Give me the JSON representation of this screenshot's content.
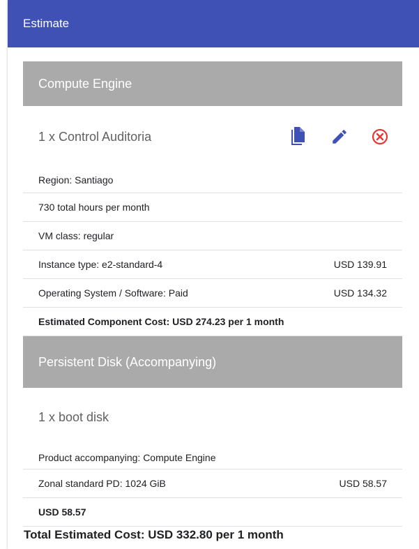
{
  "colors": {
    "header_bg": "#3f51b5",
    "section_bg": "#aaaaaa",
    "icon_blue": "#3f51b5",
    "delete_red": "#e53935"
  },
  "header": {
    "title": "Estimate"
  },
  "compute": {
    "section_title": "Compute Engine",
    "item_title": "1 x Control Auditoria",
    "actions": [
      "copy-icon",
      "edit-icon",
      "delete-icon"
    ],
    "rows": [
      {
        "label": "Region: Santiago",
        "price": ""
      },
      {
        "label": "730 total hours per month",
        "price": ""
      },
      {
        "label": "VM class: regular",
        "price": ""
      },
      {
        "label": "Instance type: e2-standard-4",
        "price": "USD 139.91"
      },
      {
        "label": "Operating System / Software: Paid",
        "price": "USD 134.32"
      }
    ],
    "component_cost": "Estimated Component Cost: USD 274.23 per 1 month"
  },
  "disk": {
    "section_title": "Persistent Disk (Accompanying)",
    "item_title": "1 x boot disk",
    "rows": [
      {
        "label": "Product accompanying: Compute Engine",
        "price": ""
      },
      {
        "label": "Zonal standard PD: 1024 GiB",
        "price": "USD 58.57"
      }
    ],
    "component_cost": "USD 58.57"
  },
  "total": "Total Estimated Cost: USD 332.80 per 1 month"
}
